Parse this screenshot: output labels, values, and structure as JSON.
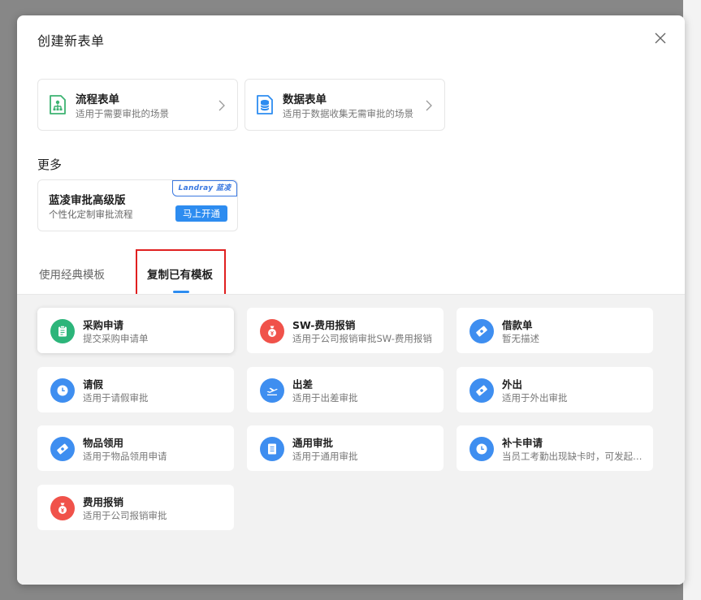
{
  "dialog": {
    "title": "创建新表单"
  },
  "form_types": [
    {
      "title": "流程表单",
      "desc": "适用于需要审批的场景",
      "icon": "process-form-icon",
      "color": "#3cb371"
    },
    {
      "title": "数据表单",
      "desc": "适用于数据收集无需审批的场景",
      "icon": "database-icon",
      "color": "#2d8cf0"
    }
  ],
  "more": {
    "heading": "更多",
    "pro": {
      "title": "蓝凌审批高级版",
      "desc": "个性化定制审批流程",
      "logo": "Landray 蓝凌",
      "button": "马上开通"
    }
  },
  "tabs": [
    {
      "label": "使用经典模板",
      "active": false
    },
    {
      "label": "复制已有模板",
      "active": true
    }
  ],
  "templates": [
    {
      "name": "采购申请",
      "desc": "提交采购申请单",
      "icon": "clipboard-icon",
      "color": "#2cb57a"
    },
    {
      "name": "SW-费用报销",
      "desc": "适用于公司报销审批SW-费用报销",
      "icon": "money-bag-icon",
      "color": "#f0524a"
    },
    {
      "name": "借款单",
      "desc": "暂无描述",
      "icon": "banknote-icon",
      "color": "#3e8ef0"
    },
    {
      "name": "请假",
      "desc": "适用于请假审批",
      "icon": "clock-icon",
      "color": "#3e8ef0"
    },
    {
      "name": "出差",
      "desc": "适用于出差审批",
      "icon": "airplane-icon",
      "color": "#3e8ef0"
    },
    {
      "name": "外出",
      "desc": "适用于外出审批",
      "icon": "banknote-icon",
      "color": "#3e8ef0"
    },
    {
      "name": "物品领用",
      "desc": "适用于物品领用申请",
      "icon": "banknote-icon",
      "color": "#3e8ef0"
    },
    {
      "name": "通用审批",
      "desc": "适用于通用审批",
      "icon": "document-icon",
      "color": "#3e8ef0"
    },
    {
      "name": "补卡申请",
      "desc": "当员工考勤出现缺卡时，可发起补卡申请",
      "icon": "clock-icon",
      "color": "#3e8ef0"
    },
    {
      "name": "费用报销",
      "desc": "适用于公司报销审批",
      "icon": "money-bag-icon",
      "color": "#f0524a"
    }
  ]
}
